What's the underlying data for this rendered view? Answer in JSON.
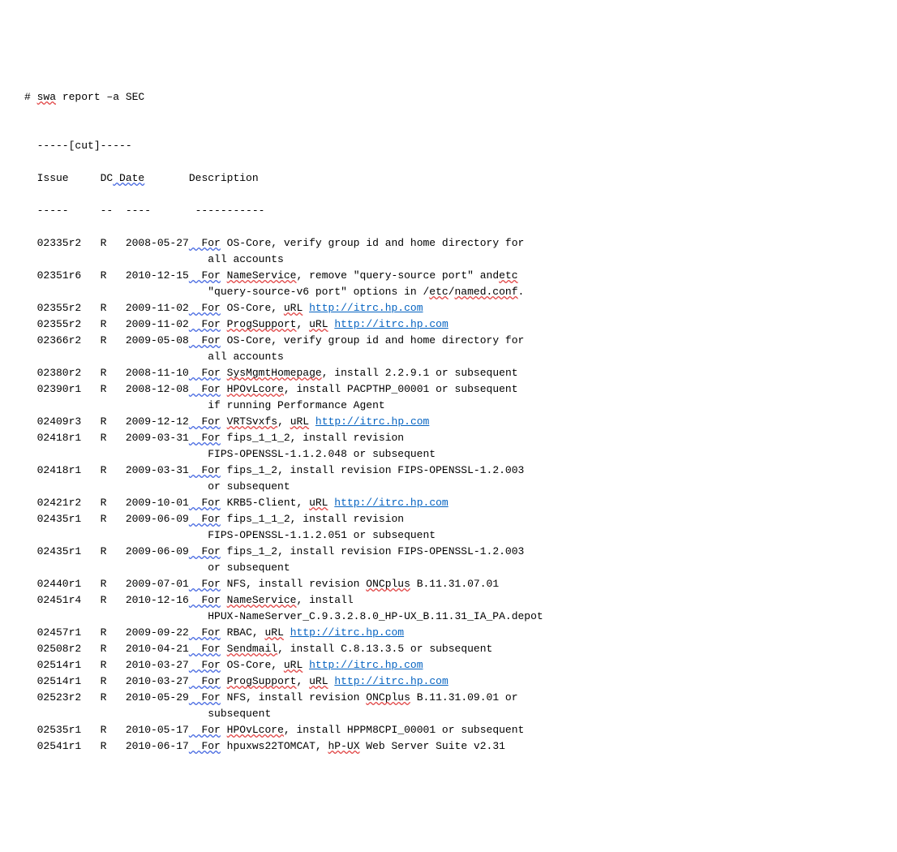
{
  "cmd_prefix": "# ",
  "cmd_swa": "swa",
  "cmd_rest": " report –a SEC",
  "cut": "  -----[cut]-----",
  "hdr_issue": "  Issue     DC",
  "hdr_date": " Date",
  "hdr_desc": "       Description",
  "rule": "  -----     --  ----       -----------",
  "rows": [
    {
      "prefix": "  02335r2   R   2008-05-27",
      "mid": "  For",
      "desc": " OS-Core, verify group id and home directory for",
      "cont": "                             all accounts"
    },
    {
      "prefix": "  02351r6   R   2010-12-15",
      "mid": "  For",
      "desc_pre": " ",
      "sq": "NameService",
      "desc_post": ", remove \"query-source port\" and",
      "cont": "                             \"query-source-v6 port\" options in /",
      "sq2": "etc",
      "cont2": "/",
      "sq3": "named.conf",
      "cont3": "."
    },
    {
      "prefix": "  02355r2   R   2009-11-02",
      "mid": "  For",
      "desc_pre": " OS-Core, ",
      "sq": "uRL",
      "link": "http://itrc.hp.com"
    },
    {
      "prefix": "  02355r2   R   2009-11-02",
      "mid": "  For",
      "desc_pre": " ",
      "sq": "ProgSupport",
      "desc_post": ", ",
      "sq2": "uRL",
      "link": "http://itrc.hp.com"
    },
    {
      "prefix": "  02366r2   R   2009-05-08",
      "mid": "  For",
      "desc": " OS-Core, verify group id and home directory for",
      "cont": "                             all accounts"
    },
    {
      "prefix": "  02380r2   R   2008-11-10",
      "mid": "  For",
      "desc_pre": " ",
      "sq": "SysMgmtHomepage",
      "desc_post": ", install 2.2.9.1 or subsequent"
    },
    {
      "prefix": "  02390r1   R   2008-12-08",
      "mid": "  For",
      "desc_pre": " ",
      "sq": "HPOvLcore",
      "desc_post": ", install PACPTHP_00001 or subsequent",
      "cont": "                             if running Performance Agent"
    },
    {
      "prefix": "  02409r3   R   2009-12-12",
      "mid": "  For",
      "desc_pre": " ",
      "sq": "VRTSvxfs",
      "desc_post": ", ",
      "sq2": "uRL",
      "link": "http://itrc.hp.com"
    },
    {
      "prefix": "  02418r1   R   2009-03-31",
      "mid": "  For",
      "desc": " fips_1_1_2, install revision",
      "cont": "                             FIPS-OPENSSL-1.1.2.048 or subsequent"
    },
    {
      "prefix": "  02418r1   R   2009-03-31",
      "mid": "  For",
      "desc": " fips_1_2, install revision FIPS-OPENSSL-1.2.003",
      "cont": "                             or subsequent"
    },
    {
      "prefix": "  02421r2   R   2009-10-01",
      "mid": "  For",
      "desc_pre": " KRB5-Client, ",
      "sq": "uRL",
      "link": "http://itrc.hp.com"
    },
    {
      "prefix": "  02435r1   R   2009-06-09",
      "mid": "  For",
      "desc": " fips_1_1_2, install revision",
      "cont": "                             FIPS-OPENSSL-1.1.2.051 or subsequent"
    },
    {
      "prefix": "  02435r1   R   2009-06-09",
      "mid": "  For",
      "desc": " fips_1_2, install revision FIPS-OPENSSL-1.2.003",
      "cont": "                             or subsequent"
    },
    {
      "prefix": "  02440r1   R   2009-07-01",
      "mid": "  For",
      "desc_pre": " NFS, install revision ",
      "sq": "ONCplus",
      "desc_post": " B.11.31.07.01"
    },
    {
      "prefix": "  02451r4   R   2010-12-16",
      "mid": "  For",
      "desc_pre": " ",
      "sq": "NameService",
      "desc_post": ", install",
      "cont": "                             HPUX-NameServer_C.9.3.2.8.0_HP-UX_B.11.31_IA_PA.depot"
    },
    {
      "prefix": "  02457r1   R   2009-09-22",
      "mid": "  For",
      "desc_pre": " RBAC, ",
      "sq": "uRL",
      "link": "http://itrc.hp.com"
    },
    {
      "prefix": "  02508r2   R   2010-04-21",
      "mid": "  For",
      "desc_pre": " ",
      "sq": "Sendmail",
      "desc_post": ", install C.8.13.3.5 or subsequent"
    },
    {
      "prefix": "  02514r1   R   2010-03-27",
      "mid": "  For",
      "desc_pre": " OS-Core, ",
      "sq": "uRL",
      "link": "http://itrc.hp.com"
    },
    {
      "prefix": "  02514r1   R   2010-03-27",
      "mid": "  For",
      "desc_pre": " ",
      "sq": "ProgSupport",
      "desc_post": ", ",
      "sq2": "uRL",
      "link": "http://itrc.hp.com"
    },
    {
      "prefix": "  02523r2   R   2010-05-29",
      "mid": "  For",
      "desc_pre": " NFS, install revision ",
      "sq": "ONCplus",
      "desc_post": " B.11.31.09.01 or",
      "cont": "                             subsequent"
    },
    {
      "prefix": "  02535r1   R   2010-05-17",
      "mid": "  For",
      "desc_pre": " ",
      "sq": "HPOvLcore",
      "desc_post": ", install HPPM8CPI_00001 or subsequent"
    },
    {
      "prefix": "  02541r1   R   2010-06-17",
      "mid": "  For",
      "desc_pre": " hpuxws22TOMCAT, ",
      "sq": "hP-UX",
      "desc_post": " Web Server Suite v2.31"
    }
  ]
}
